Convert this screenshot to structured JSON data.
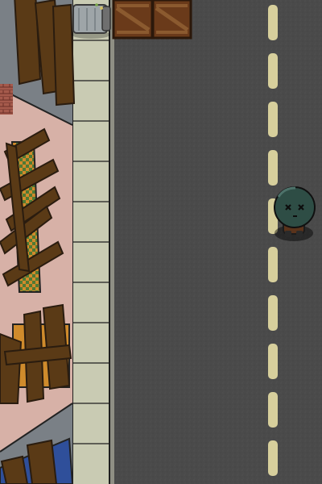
{
  "scene": {
    "colors": {
      "road": "#4a4a4a",
      "lane_paint": "#d7cf9c",
      "sidewalk": "#c9cbb3",
      "sidewalk_lines": "#1e1e1e",
      "building_floor": "#d7b1a7",
      "building_wall": "#7a8086",
      "plank": "#5a3a16",
      "plank_dark": "#3e2812",
      "crate": "#6a3a1a",
      "crate_stripe": "#8b5a2f",
      "trash_can": "#9ea5a8",
      "zombie_skin": "#2e4d45",
      "zombie_shadow": "#1f1f1f"
    },
    "objects": {
      "trash_can": "trash-can",
      "crate_left": "wood-crate",
      "crate_right": "wood-crate",
      "zombie": "zombie"
    }
  }
}
